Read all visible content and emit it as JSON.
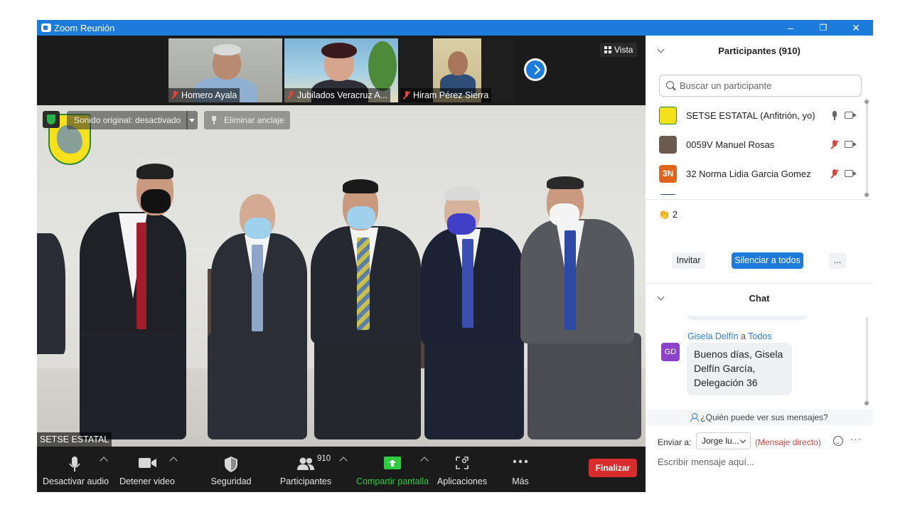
{
  "window": {
    "title": "Zoom Reunión",
    "minimize": "–",
    "restore": "❐",
    "close": "✕"
  },
  "strip": {
    "thumbs": [
      {
        "name": "Homero Ayala",
        "bg": "#b8bcb6",
        "skin": "#b98a72",
        "shirt": "#8fb0d0"
      },
      {
        "name": "Jubilados Veracruz A...",
        "bg": "#7fb5d8",
        "skin": "#d7a58e",
        "shirt": "#2e2e38"
      },
      {
        "name": "Hiram Pérez Sierra",
        "bg": "#d9cfa6",
        "skin": "#a8765a",
        "shirt": "#2f4e77"
      }
    ],
    "view_label": "Vista"
  },
  "stage": {
    "original_sound": "Sonido original: desactivado",
    "unpin_label": "Eliminar anclaje",
    "speaker_name": "SETSE ESTATAL"
  },
  "toolbar": {
    "mute": "Desactivar audio",
    "video": "Detener video",
    "security": "Seguridad",
    "participants": "Participantes",
    "participants_count": "910",
    "share": "Compartir pantalla",
    "apps": "Aplicaciones",
    "more": "Más",
    "end": "Finalizar",
    "share_color": "#2ecc40",
    "end_color": "#d92d2d"
  },
  "participants_panel": {
    "title": "Participantes (910)",
    "search_placeholder": "Buscar un participante",
    "rows": [
      {
        "name": "SETSE ESTATAL (Anfitrión, yo)",
        "avatar": "",
        "avatar_color": "#f5e11a",
        "mic": "on"
      },
      {
        "name": "0059V Manuel Rosas",
        "avatar": "",
        "avatar_color": "#6d5a4e",
        "mic": "off"
      },
      {
        "name": "32 Norma Lidia Garcia Gomez",
        "avatar": "3N",
        "avatar_color": "#e2641c",
        "mic": "off"
      }
    ],
    "reaction_icon": "👏",
    "reaction_count": "2",
    "invite": "Invitar",
    "mute_all": "Silenciar a todos",
    "more": "..."
  },
  "chat": {
    "title": "Chat",
    "sender": "Gisela Delfín",
    "to_word": "a",
    "recipient": "Todos",
    "avatar": "GD",
    "avatar_color": "#8b44c9",
    "message": "Buenos días, Gisela Delfín García, Delegación 36",
    "who_can_see": "¿Quién puede ver sus mensajes?",
    "send_to_label": "Enviar a:",
    "send_to_value": "Jorge lu...",
    "direct_label": "(Mensaje directo)",
    "compose_placeholder": "Escribir mensaje aquí..."
  }
}
